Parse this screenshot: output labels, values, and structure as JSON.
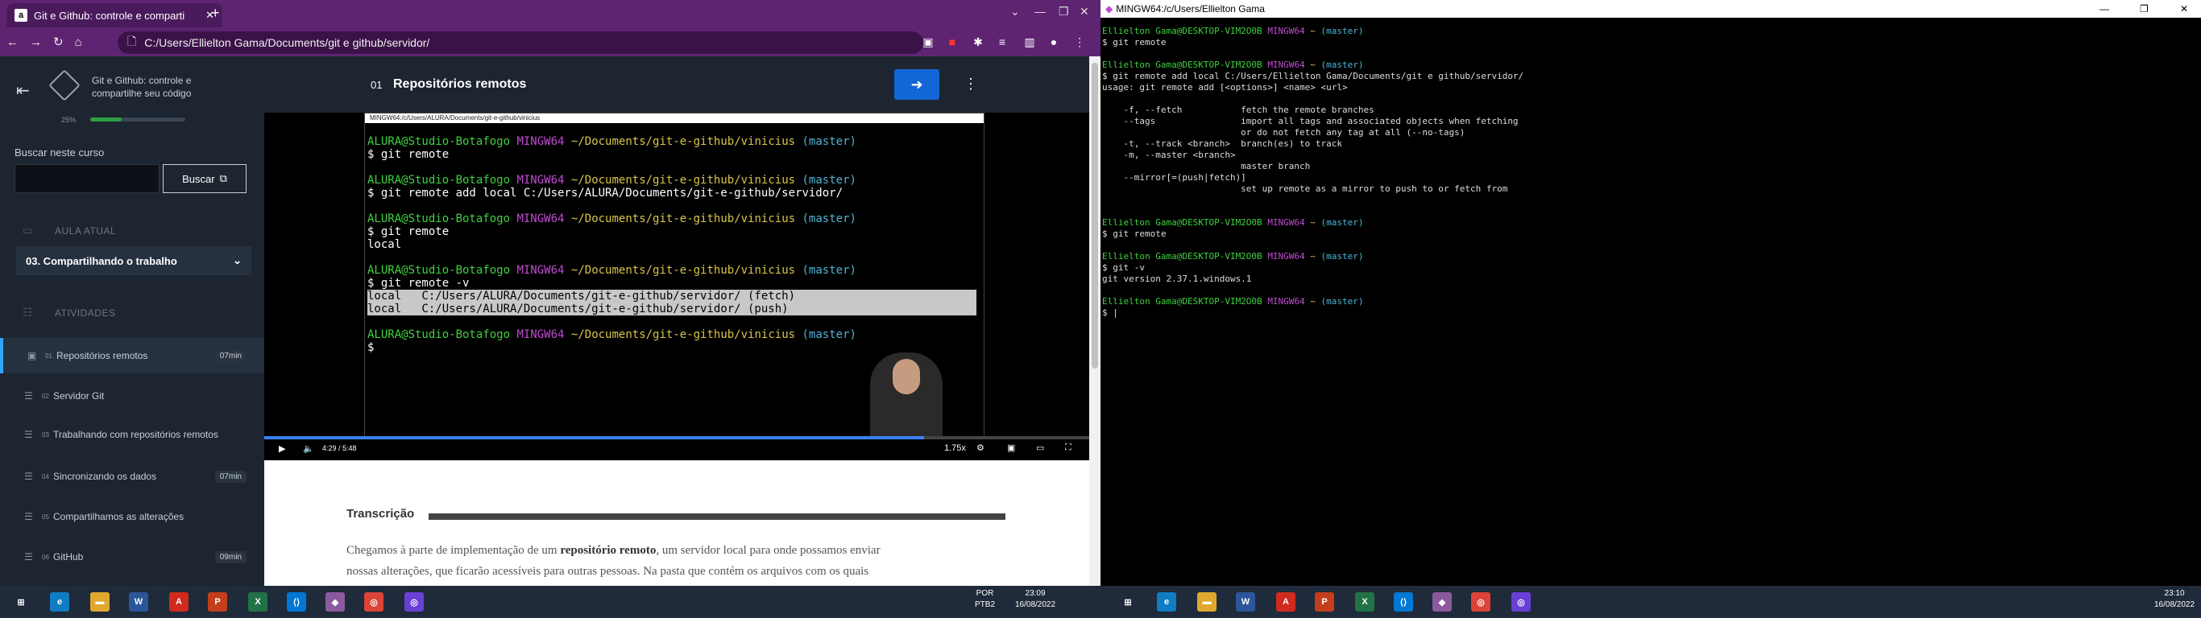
{
  "browser": {
    "tab_title": "Git e Github: controle e comparti",
    "tab_favicon": "a",
    "new_tab": "+",
    "address": "C:/Users/Ellielton Gama/Documents/git e github/servidor/"
  },
  "sidebar": {
    "course_title": "Git e Github: controle e compartilhe seu código",
    "progress_text": "25%",
    "progress_value": 0.33,
    "search_label": "Buscar neste curso",
    "search_placeholder": "",
    "search_button": "Buscar",
    "current_lesson_label": "AULA ATUAL",
    "current_lesson": "03. Compartilhando o trabalho",
    "activities_label": "ATIVIDADES",
    "activities": [
      {
        "num": "01",
        "label": "Repositórios remotos",
        "duration": "07min",
        "active": true
      },
      {
        "num": "02",
        "label": "Servidor Git",
        "duration": "",
        "active": false
      },
      {
        "num": "03",
        "label": "Trabalhando com repositórios remotos",
        "duration": "",
        "active": false
      },
      {
        "num": "04",
        "label": "Sincronizando os dados",
        "duration": "07min",
        "active": false
      },
      {
        "num": "05",
        "label": "Compartilhamos as alterações",
        "duration": "",
        "active": false
      },
      {
        "num": "06",
        "label": "GitHub",
        "duration": "09min",
        "active": false
      }
    ]
  },
  "video": {
    "number": "01",
    "title": "Repositórios remotos",
    "inner_title": "MINGW64:/c/Users/ALURA/Documents/git-e-github/vinicius",
    "time": "4:29 / 5:48",
    "speed": "1.75x",
    "lines": [
      {
        "prompt_user": "ALURA@Studio-Botafogo",
        "prompt_sys": "MINGW64",
        "prompt_path": "~/Documents/git-e-github/vinicius",
        "branch": "(master)"
      },
      {
        "cmd": "$ git remote"
      },
      {
        "prompt_user": "ALURA@Studio-Botafogo",
        "prompt_sys": "MINGW64",
        "prompt_path": "~/Documents/git-e-github/vinicius",
        "branch": "(master)"
      },
      {
        "cmd": "$ git remote add local C:/Users/ALURA/Documents/git-e-github/servidor/"
      },
      {
        "prompt_user": "ALURA@Studio-Botafogo",
        "prompt_sys": "MINGW64",
        "prompt_path": "~/Documents/git-e-github/vinicius",
        "branch": "(master)"
      },
      {
        "cmd": "$ git remote"
      },
      {
        "cmd": "local"
      },
      {
        "prompt_user": "ALURA@Studio-Botafogo",
        "prompt_sys": "MINGW64",
        "prompt_path": "~/Documents/git-e-github/vinicius",
        "branch": "(master)"
      },
      {
        "cmd": "$ git remote -v"
      },
      {
        "cmd": "local   C:/Users/ALURA/Documents/git-e-github/servidor/ (fetch)"
      },
      {
        "cmd": "local   C:/Users/ALURA/Documents/git-e-github/servidor/ (push)"
      },
      {
        "prompt_user": "ALURA@Studio-Botafogo",
        "prompt_sys": "MINGW64",
        "prompt_path": "~/Documents/git-e-github/vinicius",
        "branch": "(master)"
      },
      {
        "cmd": "$"
      }
    ]
  },
  "transcript": {
    "heading": "Transcrição",
    "p1_a": "Chegamos à parte de implementação de um ",
    "p1_b": "repositório remoto",
    "p1_c": ", um servidor local para onde possamos enviar",
    "p2": "nossas alterações, que ficarão acessíveis para outras pessoas. Na pasta que contém os arquivos com os quais"
  },
  "terminal": {
    "title": "MINGW64:/c/Users/Ellielton Gama",
    "prompt_user": "Ellielton Gama@DESKTOP-VIM2O0B",
    "prompt_sys": "MINGW64",
    "prompt_path": "~",
    "branch": "(master)",
    "cmd1": "$ git remote",
    "cmd2": "$ git remote add local C:/Users/Ellielton Gama/Documents/git e github/servidor/",
    "usage": "usage: git remote add [<options>] <name> <url>",
    "opt1": "    -f, --fetch           fetch the remote branches",
    "opt2": "    --tags                import all tags and associated objects when fetching",
    "opt3": "                          or do not fetch any tag at all (--no-tags)",
    "opt4": "    -t, --track <branch>  branch(es) to track",
    "opt5": "    -m, --master <branch>",
    "opt6": "                          master branch",
    "opt7": "    --mirror[=(push|fetch)]",
    "opt8": "                          set up remote as a mirror to push to or fetch from",
    "cmd3": "$ git remote",
    "cmd4": "$ git -v",
    "ver": "git version 2.37.1.windows.1",
    "cursor": "$ |"
  },
  "taskbar_left": {
    "lang": "POR",
    "lang2": "PTB2",
    "time": "23:09",
    "date": "16/08/2022"
  },
  "taskbar_right": {
    "time": "23:10",
    "date": "16/08/2022"
  }
}
